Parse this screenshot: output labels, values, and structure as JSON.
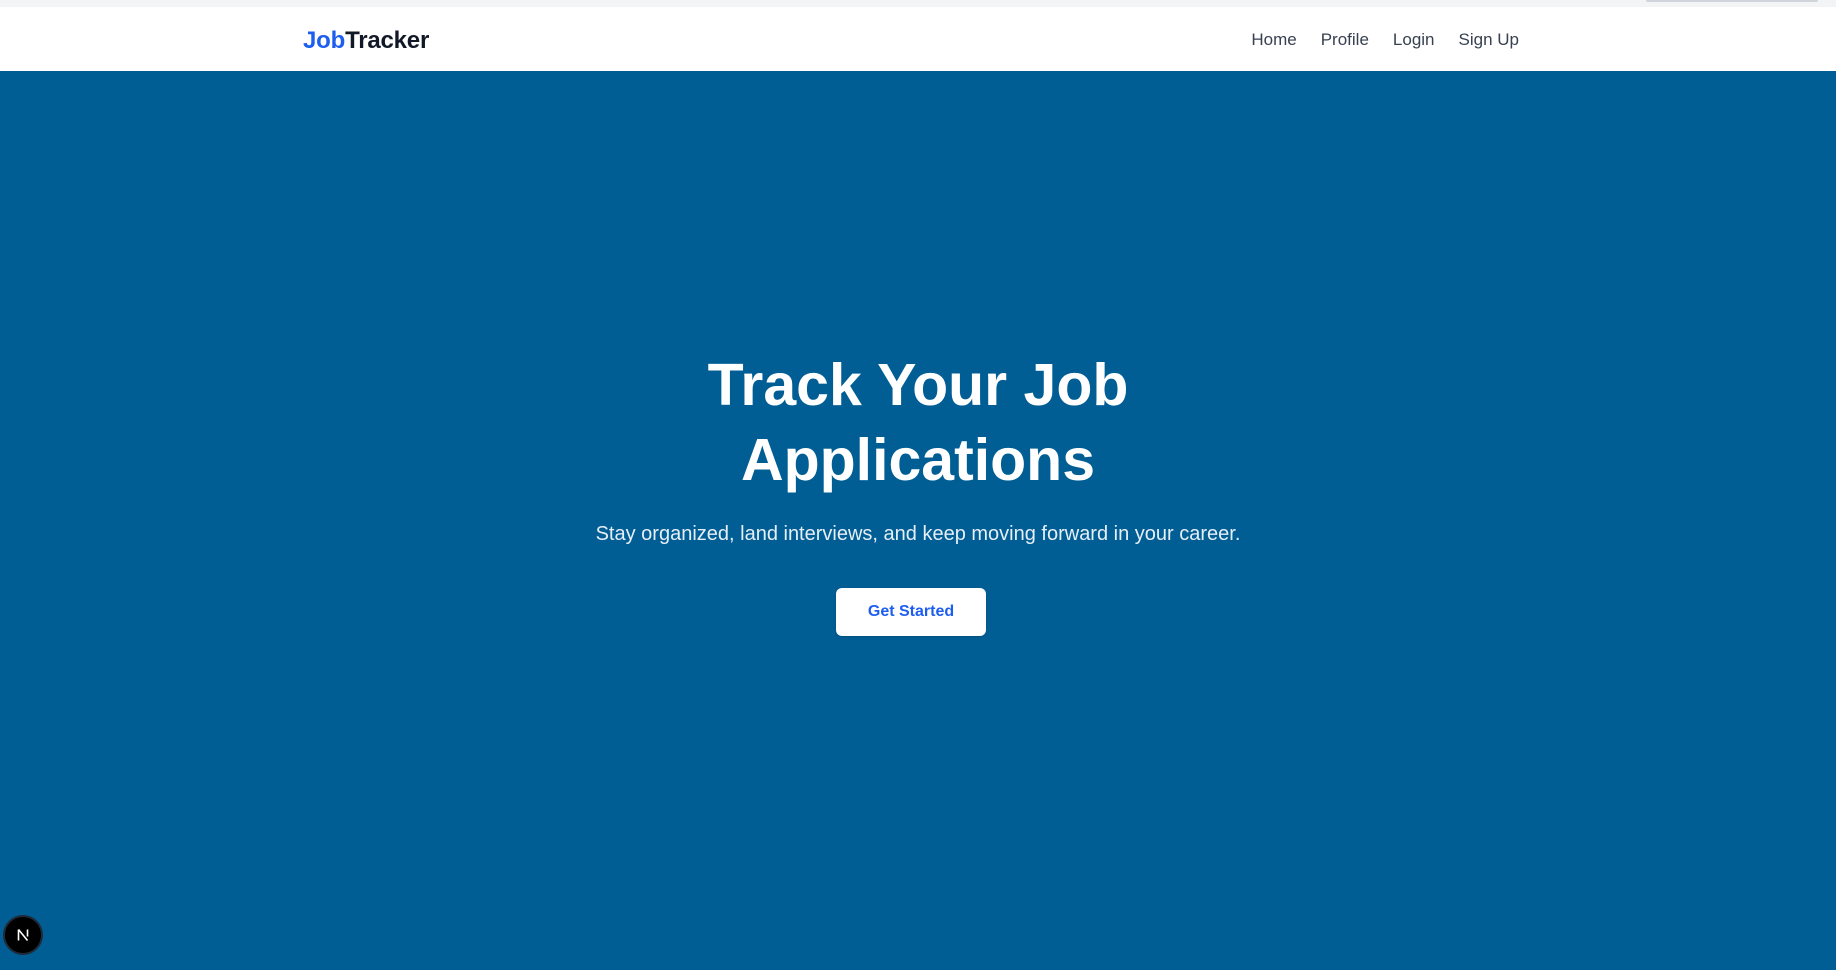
{
  "header": {
    "logo_part1": "Job",
    "logo_part2": "Tracker",
    "nav": [
      {
        "label": "Home"
      },
      {
        "label": "Profile"
      },
      {
        "label": "Login"
      },
      {
        "label": "Sign Up"
      }
    ]
  },
  "hero": {
    "title_line1": "Track Your Job",
    "title_line2": "Applications",
    "subtitle": "Stay organized, land interviews, and keep moving forward in your career.",
    "cta_label": "Get Started"
  },
  "dev_indicator": {
    "icon": "nextjs-logo-icon"
  },
  "colors": {
    "brand_blue": "#1d5ef0",
    "hero_background": "#005e95",
    "header_background": "#ffffff",
    "nav_text": "#374151"
  }
}
